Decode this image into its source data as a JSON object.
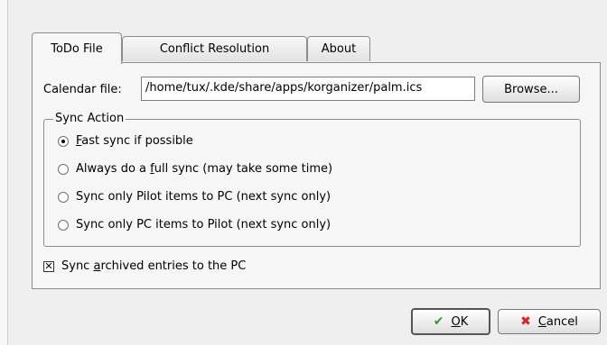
{
  "tabs": [
    {
      "label": "ToDo File",
      "active": true
    },
    {
      "label": "Conflict Resolution",
      "active": false
    },
    {
      "label": "About",
      "active": false
    }
  ],
  "calendar": {
    "label": "Calendar file:",
    "value": "/home/tux/.kde/share/apps/korganizer/palm.ics",
    "browse_label": "Browse..."
  },
  "sync_action": {
    "title": "Sync Action",
    "options": [
      {
        "pre": "",
        "mnemonic": "F",
        "post": "ast sync if possible",
        "selected": true
      },
      {
        "pre": "Always do a ",
        "mnemonic": "f",
        "post": "ull sync (may take some time)",
        "selected": false
      },
      {
        "pre": "Sync only Pilot items to PC (next sync only)",
        "mnemonic": "",
        "post": "",
        "selected": false
      },
      {
        "pre": "Sync only PC items to Pilot (next sync only)",
        "mnemonic": "",
        "post": "",
        "selected": false
      }
    ]
  },
  "archive": {
    "pre": "Sync ",
    "mnemonic": "a",
    "post": "rchived entries to the PC",
    "checked": true
  },
  "buttons": {
    "ok_mnemonic": "O",
    "ok_rest": "K",
    "cancel_mnemonic": "C",
    "cancel_rest": "ancel"
  },
  "colors": {
    "ok_icon": "#2f9a2f",
    "cancel_icon": "#dd2222"
  }
}
